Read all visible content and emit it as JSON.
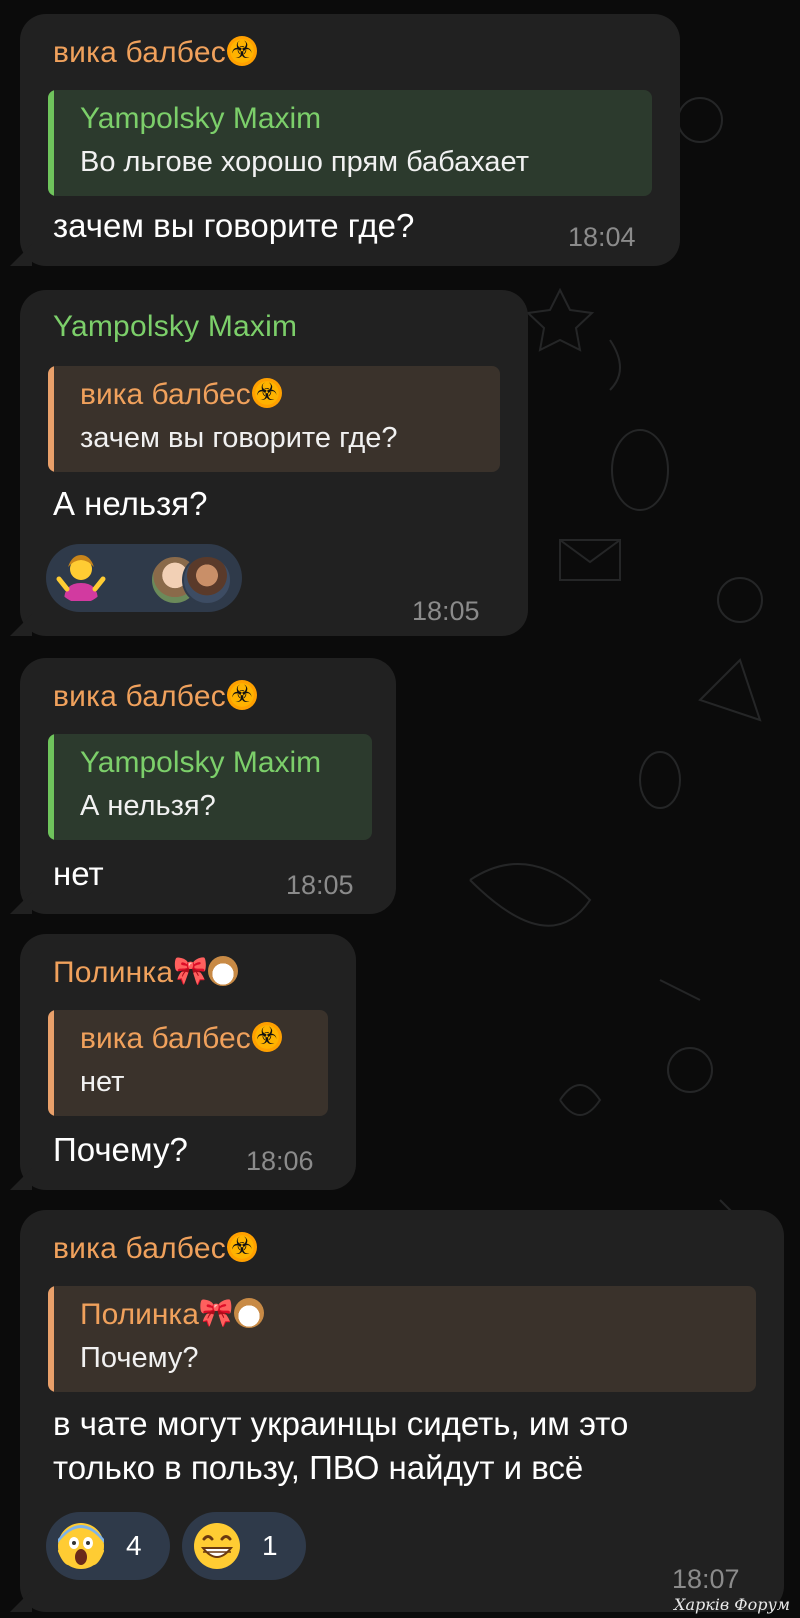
{
  "colors": {
    "background": "#0b0b0b",
    "bubble": "#212121",
    "sender_orange": "#f0a15c",
    "sender_green": "#7ccf6a",
    "time": "#8b8b8b",
    "reaction_pill": "#2f3a4a"
  },
  "messages": [
    {
      "sender": "вика балбес",
      "sender_emoji": "biohazard-icon",
      "reply": {
        "name": "Yampolsky Maxim",
        "text": "Во льгове хорошо прям бабахает"
      },
      "text": "зачем вы говорите где?",
      "time": "18:04"
    },
    {
      "sender": "Yampolsky Maxim",
      "reply": {
        "name": "вика балбес",
        "name_emoji": "biohazard-icon",
        "text": "зачем вы говорите где?"
      },
      "text": "А нельзя?",
      "reactions": [
        {
          "emoji": "person-shrugging-icon",
          "avatars": [
            "avatar-1",
            "avatar-2"
          ]
        }
      ],
      "time": "18:05"
    },
    {
      "sender": "вика балбес",
      "sender_emoji": "biohazard-icon",
      "reply": {
        "name": "Yampolsky Maxim",
        "text": "А нельзя?"
      },
      "text": "нет",
      "time": "18:05"
    },
    {
      "sender": "Полинка",
      "sender_emoji": "bow-dog-icons",
      "reply": {
        "name": "вика балбес",
        "name_emoji": "biohazard-icon",
        "text": "нет"
      },
      "text": "Почему?",
      "time": "18:06"
    },
    {
      "sender": "вика балбес",
      "sender_emoji": "biohazard-icon",
      "reply": {
        "name": "Полинка",
        "name_emoji": "bow-dog-icons",
        "text": "Почему?"
      },
      "text_line1": "в чате могут украинцы сидеть, им это",
      "text_line2": "только в пользу, ПВО найдут и всё",
      "reactions": [
        {
          "emoji": "scream-face-icon",
          "count": "4"
        },
        {
          "emoji": "grin-face-icon",
          "count": "1"
        }
      ],
      "time": "18:07"
    }
  ],
  "watermark": "Харків Форум"
}
